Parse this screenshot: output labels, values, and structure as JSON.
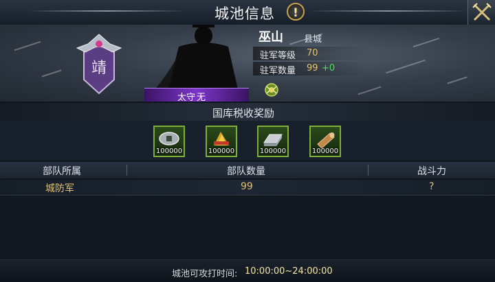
{
  "window": {
    "title": "城池信息"
  },
  "city": {
    "name": "巫山",
    "type": "县城",
    "emblem_char": "靖",
    "stats": [
      {
        "label": "驻军等级",
        "value": "70",
        "change": ""
      },
      {
        "label": "驻军数量",
        "value": "99",
        "change": "+0"
      }
    ],
    "governor": {
      "label": "太守",
      "value": "无"
    }
  },
  "tax": {
    "title": "国库税收奖励",
    "rewards": [
      {
        "icon": "coin-icon",
        "amount": "100000"
      },
      {
        "icon": "grain-icon",
        "amount": "100000"
      },
      {
        "icon": "iron-ingot-icon",
        "amount": "100000"
      },
      {
        "icon": "wood-log-icon",
        "amount": "100000"
      }
    ]
  },
  "troops": {
    "headers": [
      "部队所属",
      "部队数量",
      "战斗力"
    ],
    "rows": [
      {
        "owner": "城防军",
        "count": "99",
        "power": "?"
      }
    ]
  },
  "footer": {
    "label": "城池可攻打时间:",
    "time": "10:00:00~24:00:00"
  },
  "colors": {
    "accent_gold": "#e3c170",
    "increase_green": "#4fe05a",
    "governor_purple": "#7c35c8",
    "reward_border": "#7fae3a"
  }
}
